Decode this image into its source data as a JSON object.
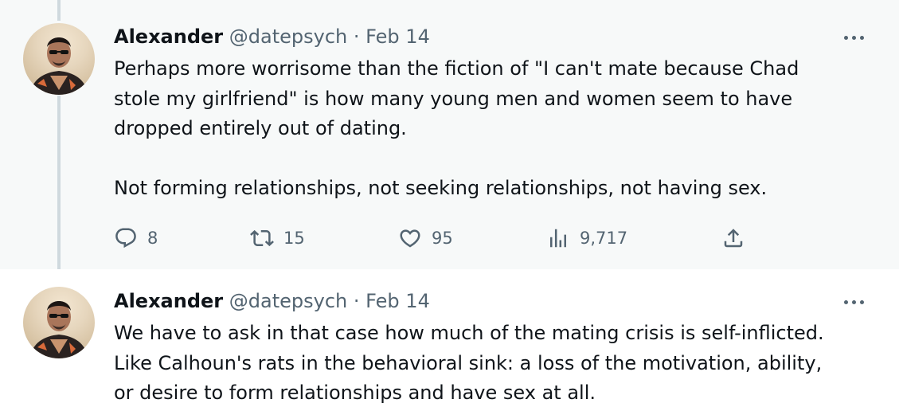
{
  "tweets": [
    {
      "author_name": "Alexander",
      "handle": "@datepsych",
      "separator": "·",
      "date": "Feb 14",
      "text_lines": [
        "Perhaps more worrisome than the fiction of \"I can't mate because Chad",
        "stole my girlfriend\" is how many young men and women seem to have",
        "dropped entirely out of dating.",
        "",
        "Not forming relationships, not seeking relationships, not having sex."
      ],
      "actions": {
        "replies": "8",
        "reposts": "15",
        "likes": "95",
        "views": "9,717"
      }
    },
    {
      "author_name": "Alexander",
      "handle": "@datepsych",
      "separator": "·",
      "date": "Feb 14",
      "text_lines": [
        "We have to ask in that case how much of the mating crisis is self-inflicted.",
        "Like Calhoun's rats in the behavioral sink: a loss of the motivation, ability,",
        "or desire to form relationships and have sex at all."
      ]
    }
  ],
  "icons": {
    "reply": "reply-icon",
    "repost": "repost-icon",
    "like": "heart-icon",
    "views": "views-icon",
    "share": "share-icon",
    "more": "more-icon"
  },
  "colors": {
    "text_primary": "#0f1419",
    "text_secondary": "#536471",
    "highlight_background": "#f7f9f9",
    "thread_line": "#cfd9de"
  }
}
